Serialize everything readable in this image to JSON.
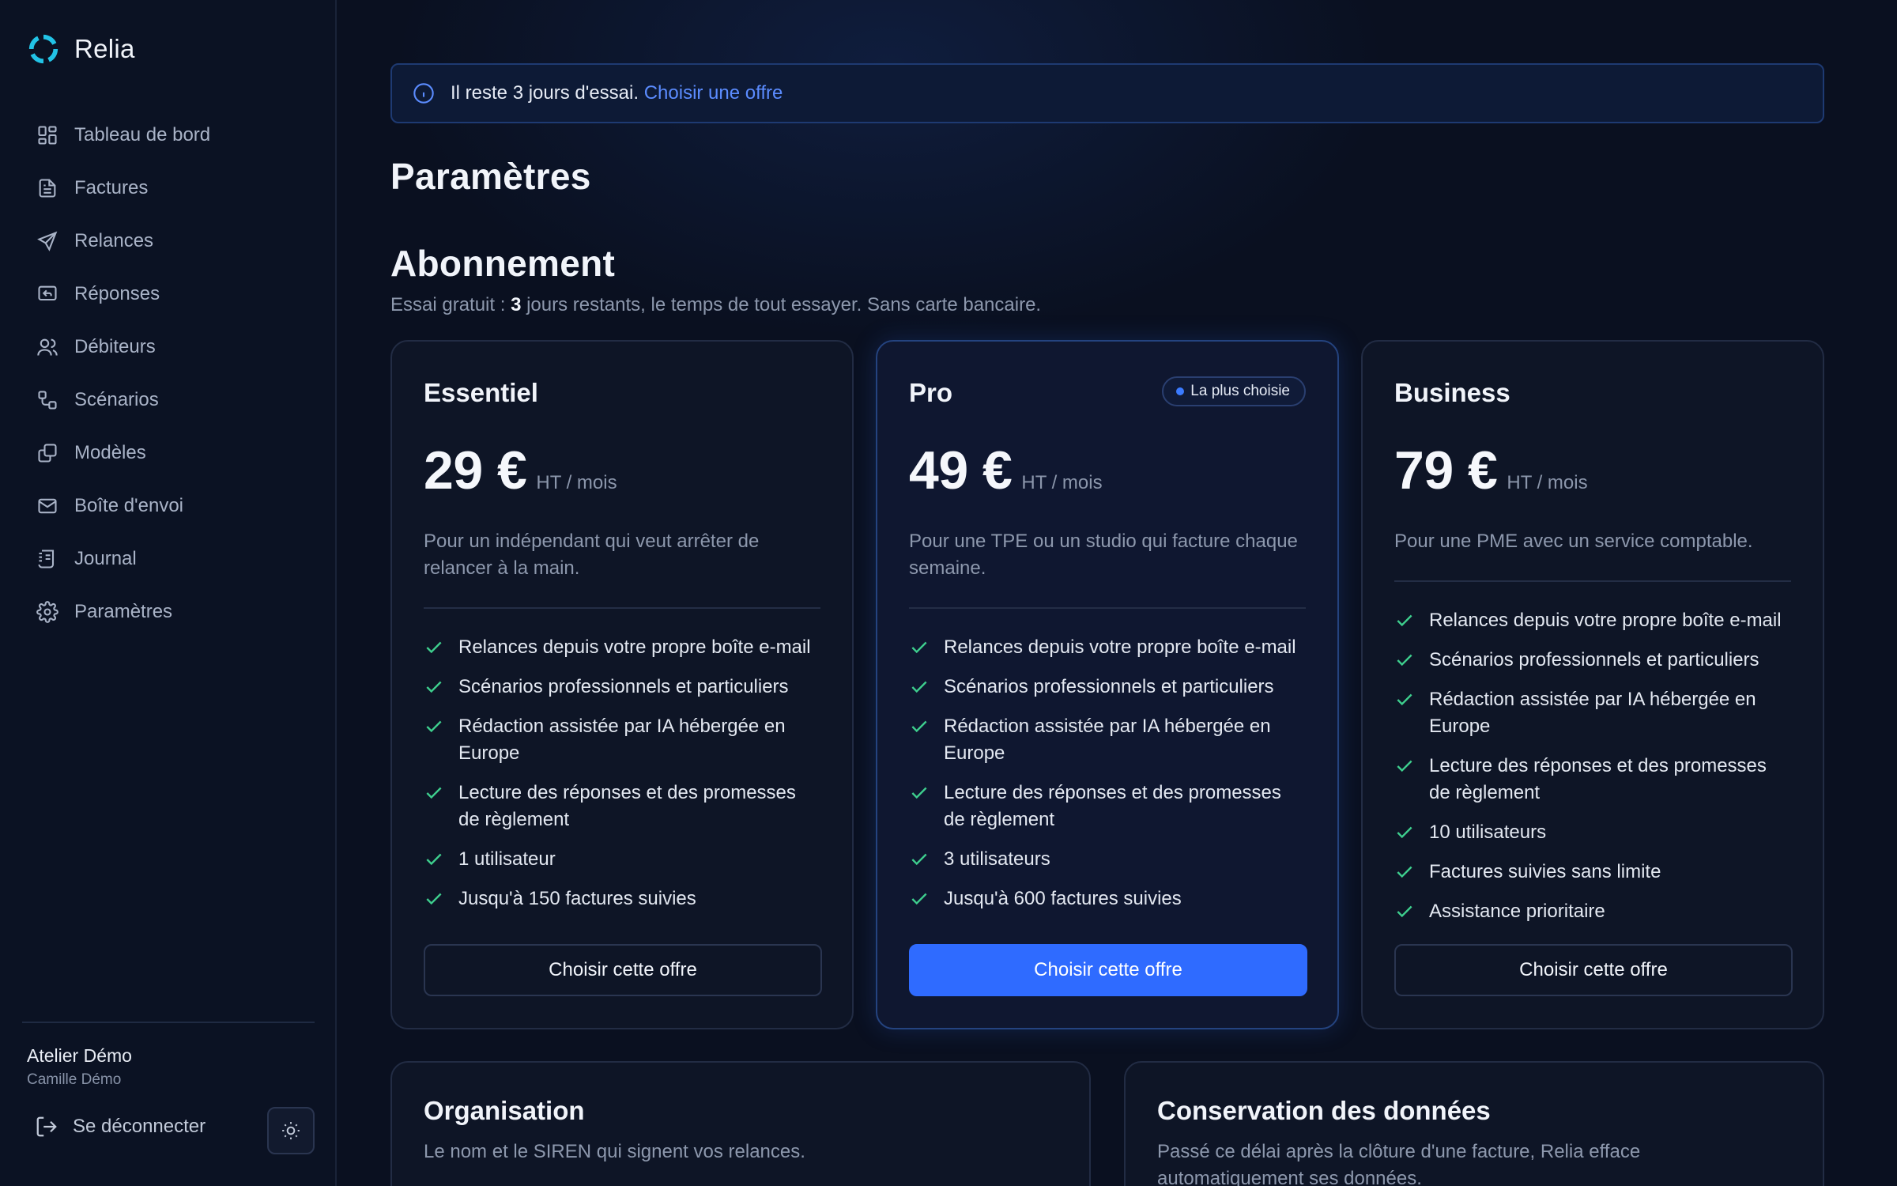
{
  "brand": {
    "name": "Relia"
  },
  "sidebar": {
    "items": [
      {
        "label": "Tableau de bord",
        "icon": "dashboard-icon"
      },
      {
        "label": "Factures",
        "icon": "invoice-icon"
      },
      {
        "label": "Relances",
        "icon": "send-icon"
      },
      {
        "label": "Réponses",
        "icon": "reply-icon"
      },
      {
        "label": "Débiteurs",
        "icon": "users-icon"
      },
      {
        "label": "Scénarios",
        "icon": "workflow-icon"
      },
      {
        "label": "Modèles",
        "icon": "templates-icon"
      },
      {
        "label": "Boîte d'envoi",
        "icon": "mail-icon"
      },
      {
        "label": "Journal",
        "icon": "journal-icon"
      },
      {
        "label": "Paramètres",
        "icon": "gear-icon"
      }
    ],
    "org_name": "Atelier Démo",
    "user_name": "Camille Démo",
    "logout_label": "Se déconnecter"
  },
  "banner": {
    "text": "Il reste 3 jours d'essai.",
    "link": "Choisir une offre"
  },
  "page_title": "Paramètres",
  "subscription": {
    "title": "Abonnement",
    "sub_prefix": "Essai gratuit : ",
    "days": "3",
    "sub_suffix": " jours restants, le temps de tout essayer. Sans carte bancaire."
  },
  "plans": [
    {
      "name": "Essentiel",
      "price": "29 €",
      "unit": "HT / mois",
      "desc": "Pour un indépendant qui veut arrêter de relancer à la main.",
      "features": [
        "Relances depuis votre propre boîte e-mail",
        "Scénarios professionnels et particuliers",
        "Rédaction assistée par IA hébergée en Europe",
        "Lecture des réponses et des promesses de règlement",
        "1 utilisateur",
        "Jusqu'à 150 factures suivies"
      ],
      "button": "Choisir cette offre"
    },
    {
      "name": "Pro",
      "badge": "La plus choisie",
      "price": "49 €",
      "unit": "HT / mois",
      "desc": "Pour une TPE ou un studio qui facture chaque semaine.",
      "features": [
        "Relances depuis votre propre boîte e-mail",
        "Scénarios professionnels et particuliers",
        "Rédaction assistée par IA hébergée en Europe",
        "Lecture des réponses et des promesses de règlement",
        "3 utilisateurs",
        "Jusqu'à 600 factures suivies"
      ],
      "button": "Choisir cette offre"
    },
    {
      "name": "Business",
      "price": "79 €",
      "unit": "HT / mois",
      "desc": "Pour une PME avec un service comptable.",
      "features": [
        "Relances depuis votre propre boîte e-mail",
        "Scénarios professionnels et particuliers",
        "Rédaction assistée par IA hébergée en Europe",
        "Lecture des réponses et des promesses de règlement",
        "10 utilisateurs",
        "Factures suivies sans limite",
        "Assistance prioritaire"
      ],
      "button": "Choisir cette offre"
    }
  ],
  "organisation": {
    "title": "Organisation",
    "desc": "Le nom et le SIREN qui signent vos relances."
  },
  "retention": {
    "title": "Conservation des données",
    "desc": "Passé ce délai après la clôture d'une facture, Relia efface automatiquement ses données."
  },
  "colors": {
    "accent": "#2f6bff",
    "link": "#5b8cff",
    "check": "#3ecf8e",
    "logo": "#22c3e6"
  }
}
